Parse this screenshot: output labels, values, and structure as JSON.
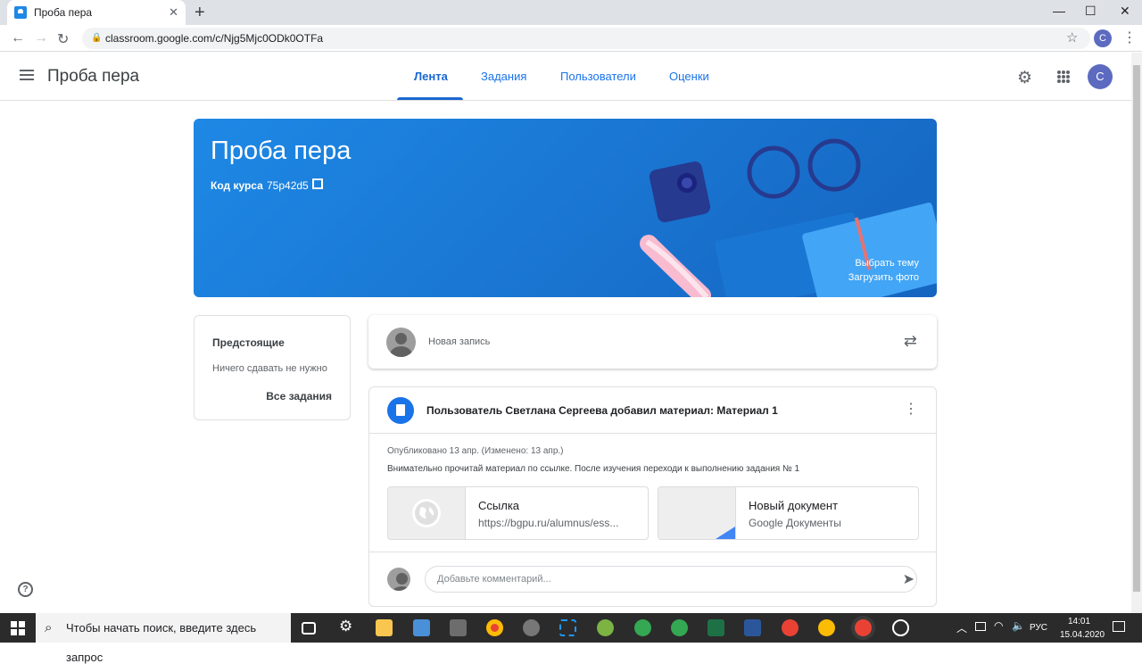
{
  "browser": {
    "tab_title": "Проба пера",
    "tab_close": "✕",
    "new_tab": "+",
    "url": "classroom.google.com/c/Njg5Mjc0ODk0OTFa",
    "profile_initial": "C",
    "win_minimize": "—",
    "win_maximize": "☐",
    "win_close": "✕"
  },
  "header": {
    "class_name": "Проба пера",
    "tabs": [
      {
        "label": "Лента"
      },
      {
        "label": "Задания"
      },
      {
        "label": "Пользователи"
      },
      {
        "label": "Оценки"
      }
    ],
    "avatar_initial": "C"
  },
  "banner": {
    "title": "Проба пера",
    "code_label": "Код курса",
    "code": "75p42d5",
    "theme_link": "Выбрать тему",
    "photo_link": "Загрузить фото"
  },
  "upcoming": {
    "title": "Предстоящие",
    "empty": "Ничего сдавать не нужно",
    "all_link": "Все задания"
  },
  "new_post": {
    "placeholder": "Новая запись"
  },
  "material": {
    "title": "Пользователь Светлана Сергеева добавил материал: Материал 1",
    "published": "Опубликовано 13 апр. (Изменено: 13 апр.)",
    "description": "Внимательно прочитай материал по ссылке. После изучения переходи к выполнению задания № 1",
    "attachments": [
      {
        "title": "Ссылка",
        "subtitle": "https://bgpu.ru/alumnus/ess..."
      },
      {
        "title": "Новый документ",
        "subtitle": "Google Документы"
      }
    ],
    "comment_placeholder": "Добавьте комментарий..."
  },
  "taskbar": {
    "search_placeholder": "Чтобы начать поиск, введите здесь запрос",
    "language": "РУС",
    "time": "14:01",
    "date": "15.04.2020"
  },
  "colors": {
    "accent": "#1a73e8",
    "banner": "#1e88e5",
    "avatar": "#5c6bc0"
  }
}
